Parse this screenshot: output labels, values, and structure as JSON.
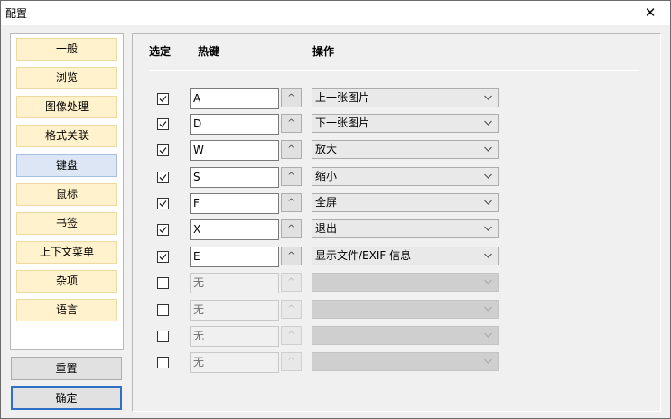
{
  "window": {
    "title": "配置",
    "close_glyph": "✕"
  },
  "sidebar": {
    "items": [
      {
        "label": "一般",
        "active": false
      },
      {
        "label": "浏览",
        "active": false
      },
      {
        "label": "图像处理",
        "active": false
      },
      {
        "label": "格式关联",
        "active": false
      },
      {
        "label": "键盘",
        "active": true
      },
      {
        "label": "鼠标",
        "active": false
      },
      {
        "label": "书签",
        "active": false
      },
      {
        "label": "上下文菜单",
        "active": false
      },
      {
        "label": "杂项",
        "active": false
      },
      {
        "label": "语言",
        "active": false
      }
    ]
  },
  "buttons": {
    "reset": "重置",
    "ok": "确定"
  },
  "table": {
    "headers": {
      "select": "选定",
      "hotkey": "热键",
      "action": "操作"
    },
    "spin_glyph": "^",
    "rows": [
      {
        "checked": true,
        "hotkey": "A",
        "action": "上一张图片"
      },
      {
        "checked": true,
        "hotkey": "D",
        "action": "下一张图片"
      },
      {
        "checked": true,
        "hotkey": "W",
        "action": "放大"
      },
      {
        "checked": true,
        "hotkey": "S",
        "action": "缩小"
      },
      {
        "checked": true,
        "hotkey": "F",
        "action": "全屏"
      },
      {
        "checked": true,
        "hotkey": "X",
        "action": "退出"
      },
      {
        "checked": true,
        "hotkey": "E",
        "action": "显示文件/EXIF 信息"
      },
      {
        "checked": false,
        "hotkey": "无",
        "action": ""
      },
      {
        "checked": false,
        "hotkey": "无",
        "action": ""
      },
      {
        "checked": false,
        "hotkey": "无",
        "action": ""
      },
      {
        "checked": false,
        "hotkey": "无",
        "action": ""
      }
    ]
  },
  "colors": {
    "active_nav": "#dce6f5",
    "nav": "#fff2cc",
    "primary_border": "#2f6fc5"
  }
}
